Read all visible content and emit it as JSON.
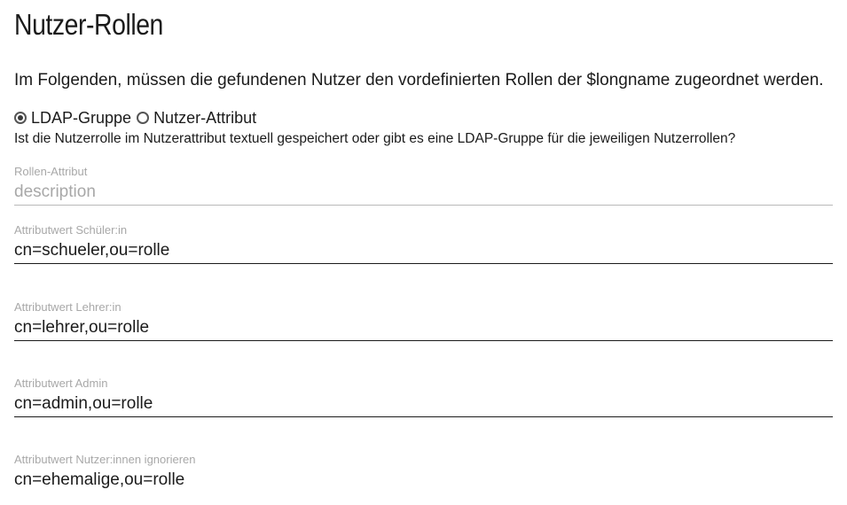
{
  "page": {
    "title": "Nutzer-Rollen",
    "intro": "Im Folgenden, müssen die gefundenen Nutzer den vordefinierten Rollen der $longname zugeordnet werden."
  },
  "radio": {
    "options": [
      {
        "label": "LDAP-Gruppe",
        "checked": true
      },
      {
        "label": "Nutzer-Attribut",
        "checked": false
      }
    ],
    "help": "Ist die Nutzerrolle im Nutzerattribut textuell gespeichert oder gibt es eine LDAP-Gruppe für die jeweiligen Nutzerrollen?"
  },
  "fields": {
    "role_attribute": {
      "label": "Rollen-Attribut",
      "value": "description",
      "disabled": true
    },
    "student": {
      "label": "Attributwert Schüler:in",
      "value": "cn=schueler,ou=rolle"
    },
    "teacher": {
      "label": "Attributwert Lehrer:in",
      "value": "cn=lehrer,ou=rolle"
    },
    "admin": {
      "label": "Attributwert Admin",
      "value": "cn=admin,ou=rolle"
    },
    "ignore": {
      "label": "Attributwert Nutzer:innen ignorieren",
      "value": "cn=ehemalige,ou=rolle"
    }
  }
}
